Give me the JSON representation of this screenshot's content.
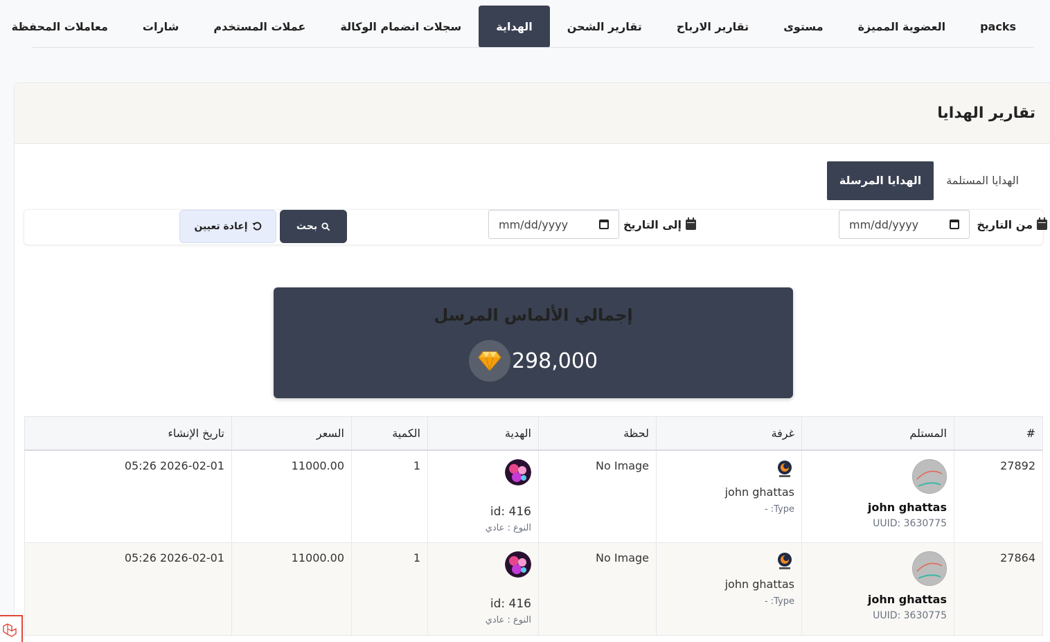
{
  "nav": {
    "items": [
      "packs",
      "العضوية المميزة",
      "مستوى",
      "تقارير الارباح",
      "تقارير الشحن",
      "الهداية",
      "سجلات انضمام الوكالة",
      "عملات المستخدم",
      "شارات",
      "معاملات المحفظة"
    ],
    "active": "الهداية"
  },
  "card": {
    "title": "تقارير الهدايا"
  },
  "subtabs": {
    "received": "الهدايا المستلمة",
    "sent": "الهدايا المرسلة"
  },
  "filters": {
    "from_label": "من التاريخ",
    "to_label": "إلى التاريخ",
    "from_placeholder": "mm/dd/yyyy",
    "to_placeholder": "mm/dd/yyyy",
    "search_label": "بحث",
    "reset_label": "إعادة تعيين"
  },
  "summary": {
    "title": "إجمالي الألماس المرسل",
    "value": "298,000"
  },
  "table": {
    "headers": [
      "#",
      "المستلم",
      "غرفة",
      "لحظة",
      "الهدية",
      "الكمية",
      "السعر",
      "تاريخ الإنشاء"
    ],
    "rows": [
      {
        "id": "27892",
        "recipient_name": "john ghattas",
        "recipient_uuid": "UUID: 3630775",
        "room_name": "john ghattas",
        "room_type": "Type: -",
        "moment": "No Image",
        "gift_id": "id: 416",
        "gift_type": "النوع : عادي",
        "quantity": "1",
        "price": "11000.00",
        "created": "2026-02-01 05:26"
      },
      {
        "id": "27864",
        "recipient_name": "john ghattas",
        "recipient_uuid": "UUID: 3630775",
        "room_name": "john ghattas",
        "room_type": "Type: -",
        "moment": "No Image",
        "gift_id": "id: 416",
        "gift_type": "النوع : عادي",
        "quantity": "1",
        "price": "11000.00",
        "created": "2026-02-01 05:26"
      }
    ]
  },
  "colors": {
    "primary": "#3a4152",
    "reset_bg": "#e8edfb",
    "header_bg": "#f7f6f2",
    "diamond": "#f5a623"
  },
  "icons": {
    "calendar": "calendar-icon",
    "search": "search-icon",
    "reset": "undo-icon",
    "diamond": "diamond-icon"
  }
}
